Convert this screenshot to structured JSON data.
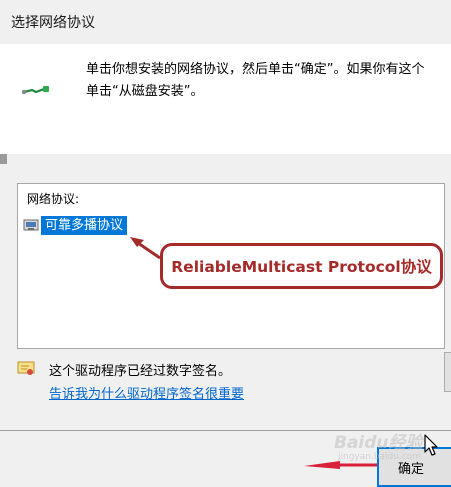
{
  "dialog": {
    "title": "选择网络协议"
  },
  "header": {
    "instruction_line1": "单击你想安装的网络协议，然后单击“确定”。如果你有这个",
    "instruction_line2": "单击“从磁盘安装”。"
  },
  "protocol_list": {
    "header": "网络协议:",
    "items": [
      {
        "label": "可靠多播协议",
        "selected": true
      }
    ]
  },
  "callout": {
    "text": "ReliableMulticast Protocol协议",
    "color": "#a52a2a"
  },
  "signature": {
    "status_text": "这个驱动程序已经过数字签名。",
    "link_text": "告诉我为什么驱动程序签名很重要"
  },
  "buttons": {
    "ok_label": "确定"
  },
  "watermark": {
    "text": "Baidu经验",
    "sub": "jingyan.baidu.com"
  },
  "colors": {
    "selection": "#0078d7",
    "link": "#0066cc",
    "annotation": "#a52a2a",
    "arrow": "#d8203a"
  },
  "icons": {
    "header": "network-cable-icon",
    "list_item": "protocol-icon",
    "signature": "certificate-icon",
    "pointer": "mouse-cursor-icon"
  }
}
